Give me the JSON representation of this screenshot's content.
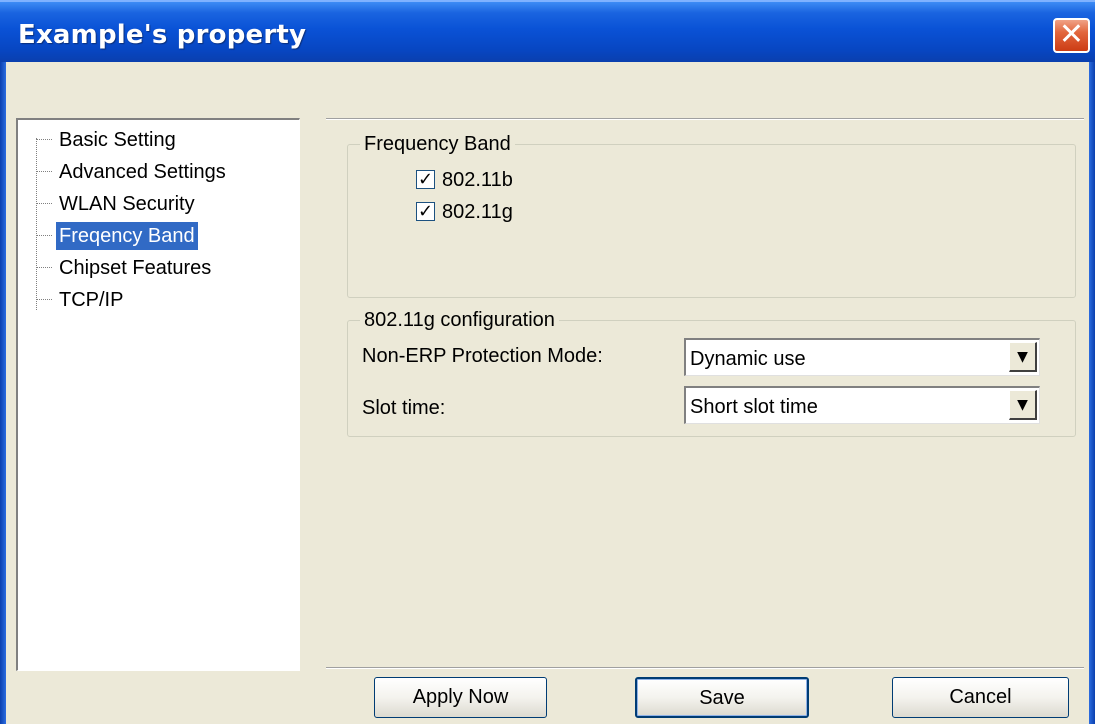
{
  "window": {
    "title": "Example's property",
    "close_label": "✕"
  },
  "tree": {
    "items": [
      {
        "label": "Basic Setting",
        "selected": false
      },
      {
        "label": "Advanced Settings",
        "selected": false
      },
      {
        "label": "WLAN Security",
        "selected": false
      },
      {
        "label": "Freqency Band",
        "selected": true
      },
      {
        "label": "Chipset Features",
        "selected": false
      },
      {
        "label": "TCP/IP",
        "selected": false
      }
    ]
  },
  "frequency_band": {
    "legend": "Frequency Band",
    "options": [
      {
        "label": "802.11b",
        "checked": true,
        "mark": "✓"
      },
      {
        "label": "802.11g",
        "checked": true,
        "mark": "✓"
      }
    ]
  },
  "g_config": {
    "legend": "802.11g configuration",
    "protection_label": "Non-ERP Protection Mode:",
    "protection_value": "Dynamic use",
    "slot_label": "Slot time:",
    "slot_value": "Short slot time",
    "arrow": "▼"
  },
  "buttons": {
    "apply": "Apply Now",
    "save": "Save",
    "cancel": "Cancel"
  }
}
